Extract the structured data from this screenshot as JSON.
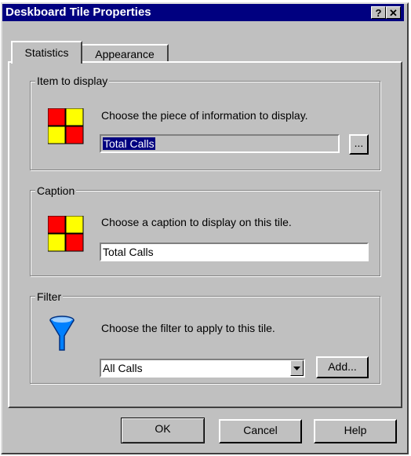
{
  "window": {
    "title": "Deskboard Tile Properties",
    "help_glyph": "?",
    "close_glyph": "✕"
  },
  "tabs": [
    {
      "label": "Statistics",
      "active": true
    },
    {
      "label": "Appearance",
      "active": false
    }
  ],
  "item_group": {
    "label": "Item to display",
    "description": "Choose the piece of information to display.",
    "value": "Total Calls",
    "browse_label": "...",
    "icon": "tile-grid-icon"
  },
  "caption_group": {
    "label": "Caption",
    "description": "Choose a caption to display on this tile.",
    "value": "Total Calls",
    "icon": "tile-grid-icon"
  },
  "filter_group": {
    "label": "Filter",
    "description": "Choose the filter to apply to this tile.",
    "selected": "All Calls",
    "add_label": "Add...",
    "icon": "funnel-icon"
  },
  "buttons": {
    "ok": "OK",
    "cancel": "Cancel",
    "help": "Help"
  },
  "colors": {
    "title_bar": "#000080",
    "dialog_bg": "#c0c0c0",
    "tile_red": "#ff0000",
    "tile_yellow": "#ffff00",
    "funnel_blue": "#0080ff"
  }
}
